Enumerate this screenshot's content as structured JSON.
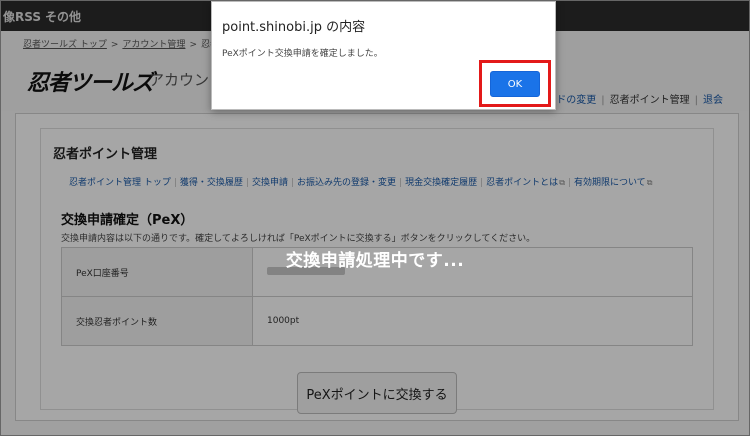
{
  "topbar": {
    "item1": "像RSS",
    "item2": "その他"
  },
  "breadcrumb": {
    "item1": "忍者ツールズ トップ",
    "item2": "アカウント管理",
    "item3": "忍者"
  },
  "header": {
    "logo": "忍者ツールズ",
    "subtitle": "アカウント",
    "links": [
      "ードの変更",
      "忍者ポイント管理",
      "退会"
    ]
  },
  "panel": {
    "title": "忍者ポイント管理",
    "subnav": [
      "忍者ポイント管理 トップ",
      "獲得・交換履歴",
      "交換申請",
      "お振込み先の登録・変更",
      "現金交換確定履歴",
      "忍者ポイントとは",
      "有効期限について"
    ],
    "section_title": "交換申請確定（PeX）",
    "description": "交換申請内容は以下の通りです。確定してよろしければ「PeXポイントに交換する」ボタンをクリックしてください。",
    "rows": [
      {
        "label": "PeX口座番号",
        "value": ""
      },
      {
        "label": "交換忍者ポイント数",
        "value": "1000pt"
      }
    ],
    "button": "PeXポイントに交換する"
  },
  "overlay": {
    "message": "交換申請処理中です..."
  },
  "dialog": {
    "title": "point.shinobi.jp の内容",
    "message": "PeXポイント交換申請を確定しました。",
    "ok": "OK"
  }
}
